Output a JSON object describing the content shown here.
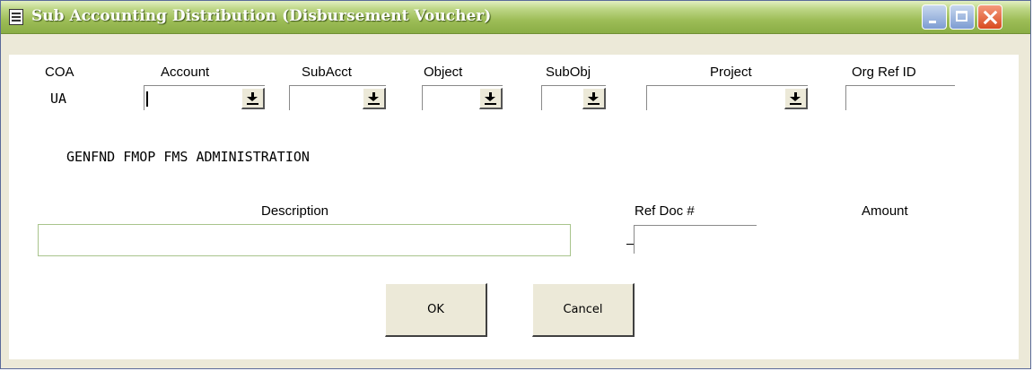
{
  "window": {
    "title": "Sub Accounting Distribution (Disbursement Voucher)",
    "title_icon": "document-icon",
    "controls": [
      "minimize-icon",
      "maximize-icon",
      "close-icon"
    ],
    "title_color": "#ffffff",
    "titlebar_color": "#9dbd57"
  },
  "headers": {
    "coa": "COA",
    "account": "Account",
    "subacct": "SubAcct",
    "object": "Object",
    "subobj": "SubObj",
    "project": "Project",
    "org_ref_id": "Org Ref ID"
  },
  "values": {
    "coa": "UA",
    "account": "",
    "subacct": "",
    "object": "",
    "subobj": "",
    "project": "",
    "org_ref_id": ""
  },
  "account_description": "GENFND FMOP FMS ADMINISTRATION",
  "detail": {
    "description_label": "Description",
    "description_value": "",
    "ref_doc_label": "Ref Doc #",
    "ref_doc_value": "",
    "amount_label": "Amount"
  },
  "buttons": {
    "ok": "OK",
    "cancel": "Cancel"
  }
}
